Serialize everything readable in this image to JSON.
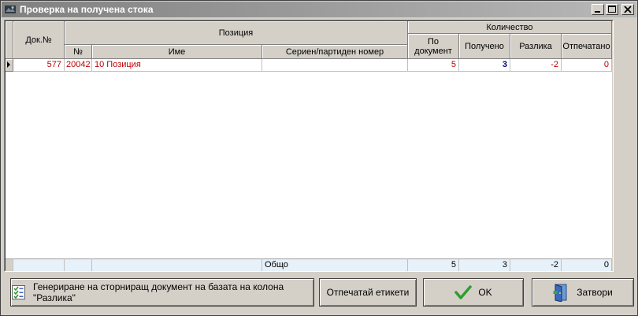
{
  "window": {
    "title": "Проверка на получена стока"
  },
  "table": {
    "headers": {
      "doc_no": "Док.№",
      "position": "Позиция",
      "quantity": "Количество",
      "num": "№",
      "name": "Име",
      "serial": "Сериен/партиден номер",
      "per_doc": "По документ",
      "received": "Получено",
      "difference": "Разлика",
      "printed": "Отпечатано"
    },
    "rows": [
      {
        "doc_no": "577",
        "num": "20042",
        "name": "10 Позиция",
        "serial": "",
        "per_doc": "5",
        "received": "3",
        "difference": "-2",
        "printed": "0"
      }
    ],
    "footer": {
      "label": "Общо",
      "per_doc": "5",
      "received": "3",
      "difference": "-2",
      "printed": "0"
    }
  },
  "buttons": {
    "generate": "Генериране на сторниращ документ на базата на колона \"Разлика\"",
    "print_labels": "Отпечатай етикети",
    "ok": "OK",
    "close": "Затвори"
  },
  "colors": {
    "value_red": "#c00000",
    "value_blue": "#000080",
    "footer_bg": "#e6f1fa"
  }
}
